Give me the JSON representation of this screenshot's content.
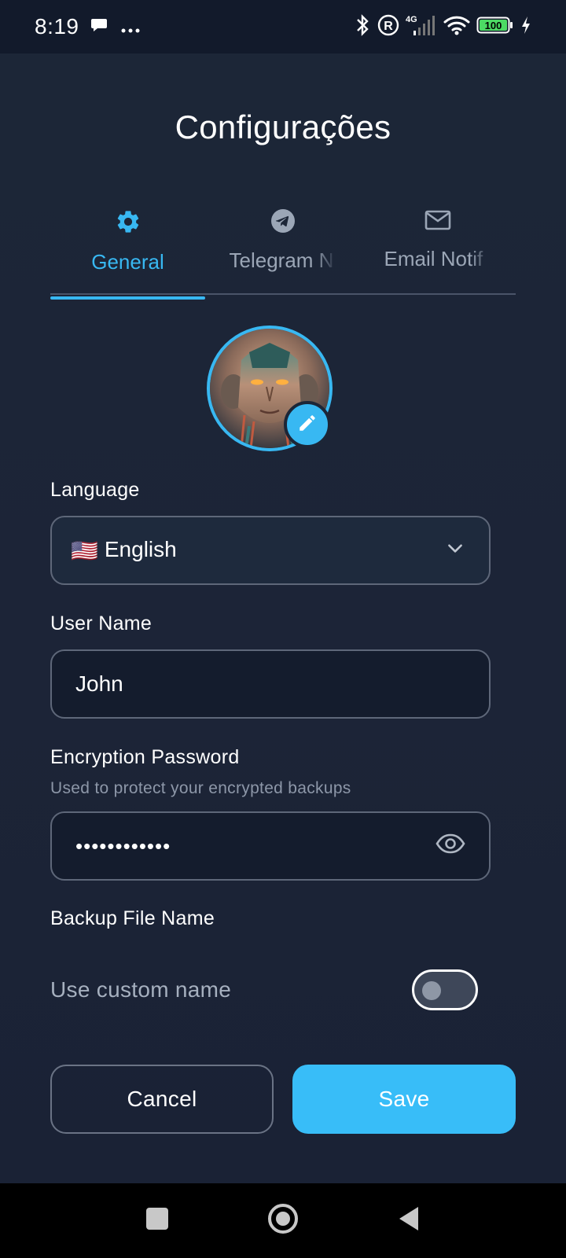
{
  "status_bar": {
    "time": "8:19",
    "network_label": "4G",
    "battery": "100",
    "icons": [
      "chat-bubble-icon",
      "more-dots-icon",
      "bluetooth-icon",
      "registered-icon",
      "signal-icon",
      "wifi-icon",
      "battery-icon",
      "charging-icon"
    ]
  },
  "page": {
    "title": "Configurações"
  },
  "tabs": [
    {
      "label": "General",
      "icon": "gear-icon",
      "active": true
    },
    {
      "label": "Telegram Notifications",
      "icon": "telegram-icon",
      "active": false
    },
    {
      "label": "Email Notifications",
      "icon": "mail-icon",
      "active": false
    }
  ],
  "visible_tab_labels": [
    "General",
    "Telegram N",
    "Email Notif"
  ],
  "avatar": {
    "edit_icon": "pencil-icon"
  },
  "form": {
    "language": {
      "label": "Language",
      "flag": "🇺🇸",
      "value": "English"
    },
    "username": {
      "label": "User Name",
      "value": "John"
    },
    "encryption_password": {
      "label": "Encryption Password",
      "hint": "Used to protect your encrypted backups",
      "value": "••••••••••••"
    },
    "backup_file_name": {
      "label": "Backup File Name",
      "toggle_label": "Use custom name",
      "toggle_on": false
    }
  },
  "buttons": {
    "cancel": "Cancel",
    "save": "Save"
  },
  "colors": {
    "accent": "#38b8f2",
    "background": "#1c2637",
    "input_background": "#141c2d"
  }
}
